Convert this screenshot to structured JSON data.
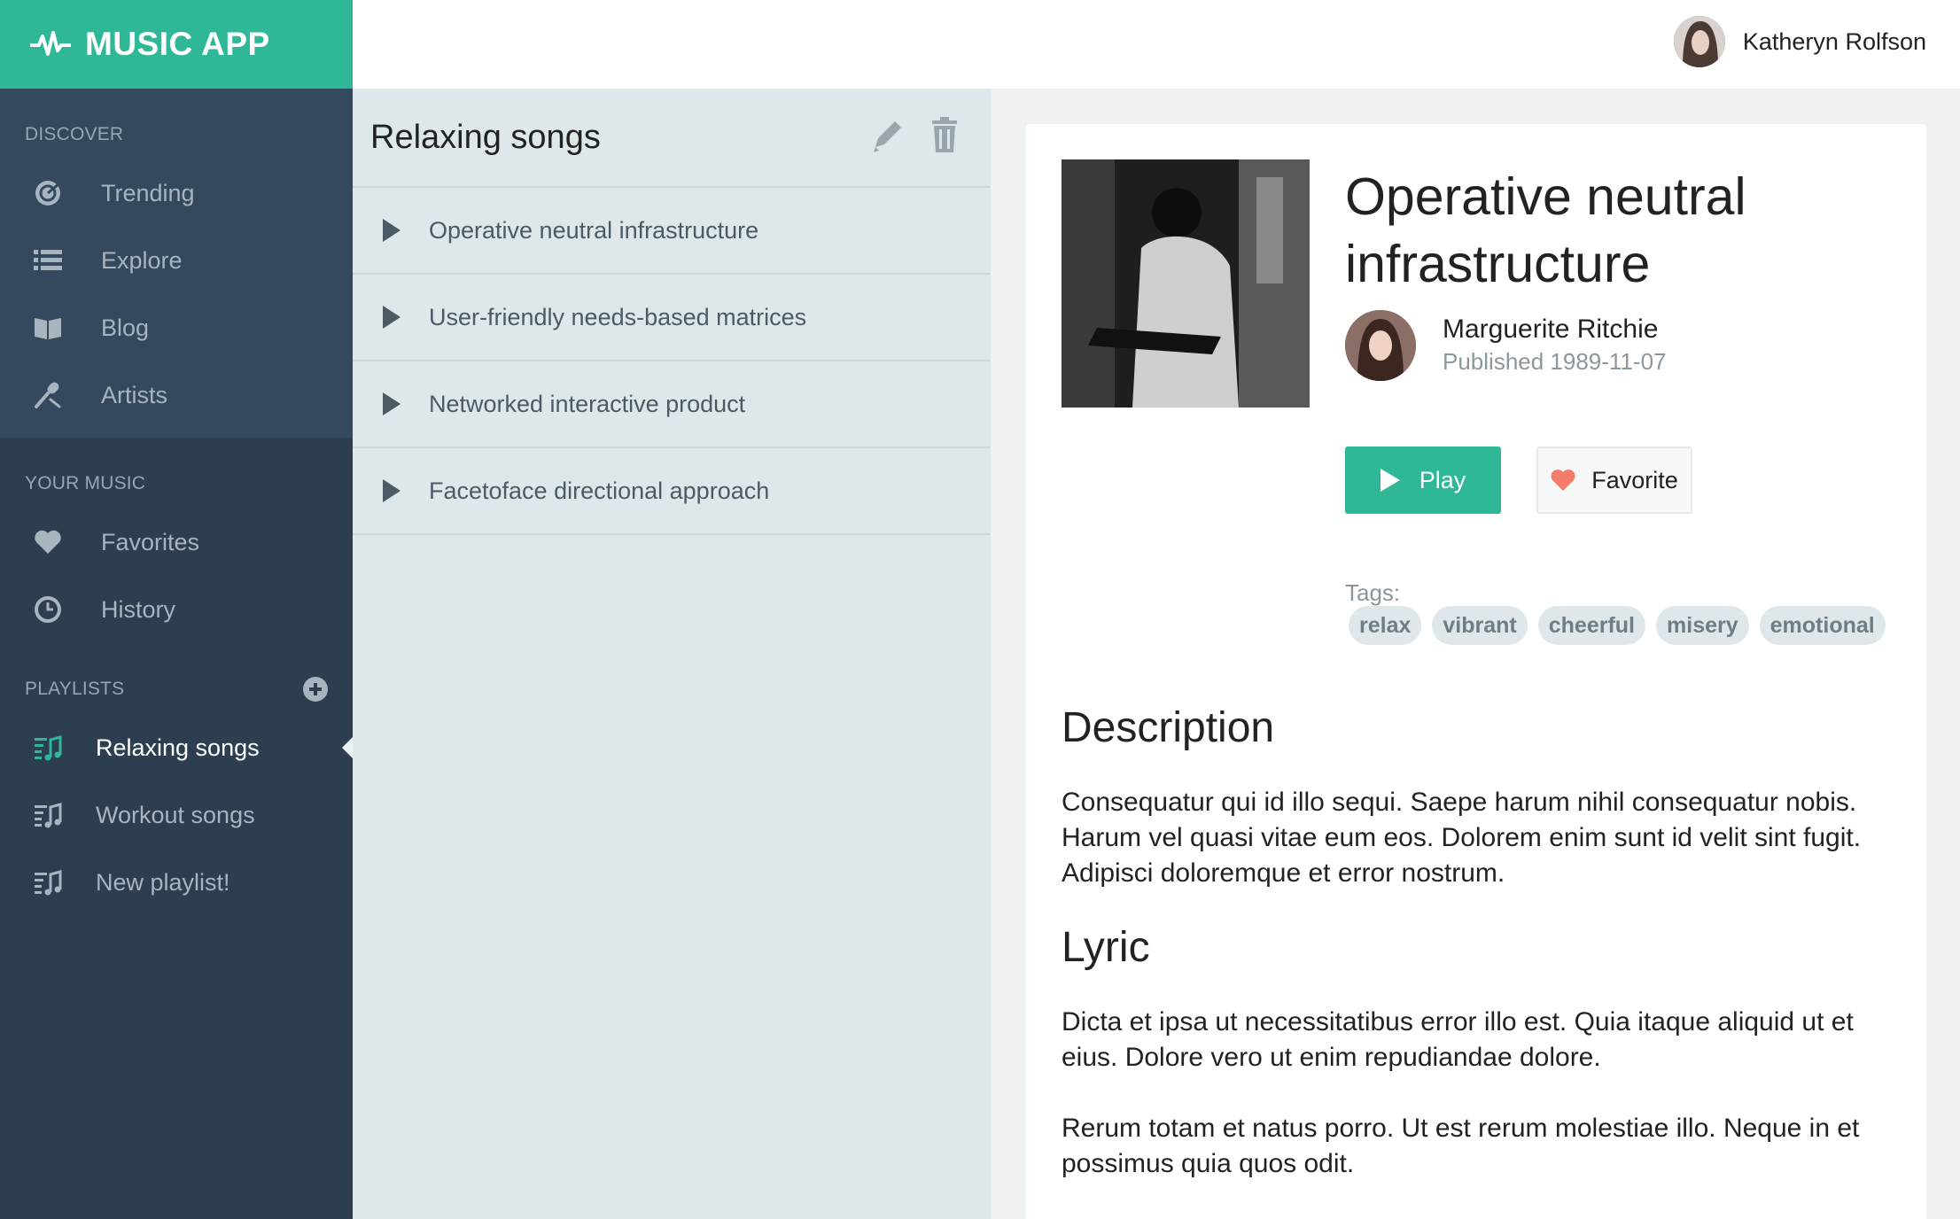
{
  "app": {
    "logo_text": "MUSIC APP",
    "accent": "#2eb897"
  },
  "user": {
    "name": "Katheryn Rolfson"
  },
  "sidebar": {
    "discover_title": "DISCOVER",
    "discover_items": [
      {
        "label": "Trending",
        "icon": "trending-icon"
      },
      {
        "label": "Explore",
        "icon": "list-icon"
      },
      {
        "label": "Blog",
        "icon": "book-icon"
      },
      {
        "label": "Artists",
        "icon": "microphone-icon"
      }
    ],
    "your_music_title": "YOUR MUSIC",
    "your_music_items": [
      {
        "label": "Favorites",
        "icon": "heart-icon"
      },
      {
        "label": "History",
        "icon": "clock-icon"
      }
    ],
    "playlists_title": "PLAYLISTS",
    "playlists": [
      {
        "label": "Relaxing songs",
        "active": true
      },
      {
        "label": "Workout songs",
        "active": false
      },
      {
        "label": "New playlist!",
        "active": false
      }
    ]
  },
  "playlist_panel": {
    "title": "Relaxing songs",
    "songs": [
      "Operative neutral infrastructure",
      "User-friendly needs-based matrices",
      "Networked interactive product",
      "Facetoface directional approach"
    ]
  },
  "detail": {
    "title": "Operative neutral infrastructure",
    "artist": "Marguerite Ritchie",
    "published": "Published 1989-11-07",
    "play_label": "Play",
    "favorite_label": "Favorite",
    "tags_label": "Tags:",
    "tags": [
      "relax",
      "vibrant",
      "cheerful",
      "misery",
      "emotional"
    ],
    "description_heading": "Description",
    "description": "Consequatur qui id illo sequi. Saepe harum nihil consequatur nobis. Harum vel quasi vitae eum eos. Dolorem enim sunt id velit sint fugit. Adipisci doloremque et error nostrum.",
    "lyric_heading": "Lyric",
    "lyric_paragraphs": [
      "Dicta et ipsa ut necessitatibus error illo est. Quia itaque aliquid ut et eius. Dolore vero ut enim repudiandae dolore.",
      "Rerum totam et natus porro. Ut est rerum molestiae illo. Neque in et possimus quia quos odit."
    ]
  }
}
